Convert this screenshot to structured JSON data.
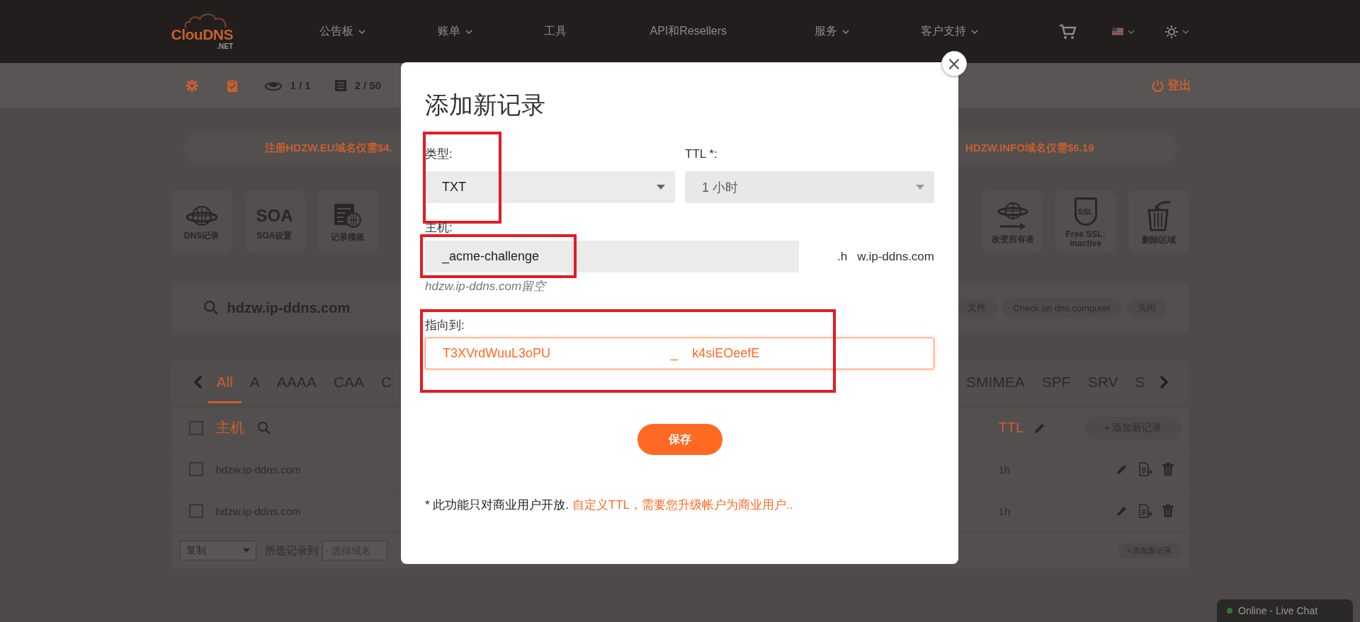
{
  "nav": {
    "logo": "ClouDNS",
    "logo_sub": ".NET",
    "menu": [
      {
        "label": "公告板",
        "dropdown": true
      },
      {
        "label": "账单",
        "dropdown": true
      },
      {
        "label": "工具",
        "dropdown": false
      },
      {
        "label": "API和Resellers",
        "dropdown": false
      },
      {
        "label": "服务",
        "dropdown": true
      },
      {
        "label": "客户支持",
        "dropdown": true
      }
    ]
  },
  "subbar": {
    "zones": "1 / 1",
    "records": "2 / 50",
    "logout": "登出"
  },
  "promo": [
    "注册HDZW.EU域名仅需$4.",
    "HDZW.INFO域名仅需$6.19"
  ],
  "tools_left": [
    {
      "kind": "globe",
      "label": "DNS记录"
    },
    {
      "kind": "soa",
      "icon_text": "SOA",
      "label": "SOA设置"
    },
    {
      "kind": "template",
      "label": "记录模板"
    }
  ],
  "tools_right": [
    {
      "kind": "owner",
      "label": "改变所有者"
    },
    {
      "kind": "ssl",
      "icon_text": "SSL",
      "label": "Free SSL: inactive"
    },
    {
      "kind": "delete",
      "label": "删除区域"
    }
  ],
  "zone_search": {
    "domain": "hdzw.ip-ddns.com",
    "actions": [
      "文件",
      "Check on dns.computer",
      "关闭"
    ]
  },
  "record_types": {
    "left": [
      {
        "label": "All",
        "selected": true
      },
      {
        "label": "A",
        "selected": false
      },
      {
        "label": "AAAA",
        "selected": false
      },
      {
        "label": "CAA",
        "selected": false
      },
      {
        "label": "C",
        "selected": false
      }
    ],
    "right": [
      {
        "label": "SMIMEA",
        "selected": false
      },
      {
        "label": "SPF",
        "selected": false
      },
      {
        "label": "SRV",
        "selected": false
      },
      {
        "label": "S",
        "selected": false
      }
    ]
  },
  "table": {
    "header": {
      "host": "主机",
      "ttl": "TTL",
      "add": "+ 添加新记录",
      "checked": false
    },
    "rows": [
      {
        "host": "hdzw.ip-ddns.com",
        "ttl": "1h",
        "checked": false
      },
      {
        "host": "hdzw.ip-ddns.com",
        "ttl": "1h",
        "checked": false
      }
    ]
  },
  "footer": {
    "action": "复制",
    "label": "所选记录到",
    "domain_placeholder": "- 选择域名",
    "add": "+ 添加新记录"
  },
  "modal": {
    "title": "添加新记录",
    "close": "×",
    "type_field": {
      "label": "类型:",
      "value": "TXT",
      "disabled": false,
      "highlighted": true
    },
    "ttl_field": {
      "label": "TTL *:",
      "value": "1 小时",
      "disabled": true
    },
    "host_field": {
      "label": "主机:",
      "value": "_acme-challenge",
      "suffix": ".h   w.ip-ddns.com",
      "hint": "hdzw.ip-ddns.com留空",
      "highlighted": true
    },
    "target_field": {
      "label": "指向到:",
      "value": "T3XVrdWuuL3oPU                                  _    k4siEOeefE",
      "highlighted": true
    },
    "save": "保存",
    "note": "* 此功能只对商业用户开放.",
    "note_link": "自定义TTL，需要您升级帐户为商业用户.."
  },
  "chat": {
    "label": "Online - Live Chat",
    "online": true
  }
}
